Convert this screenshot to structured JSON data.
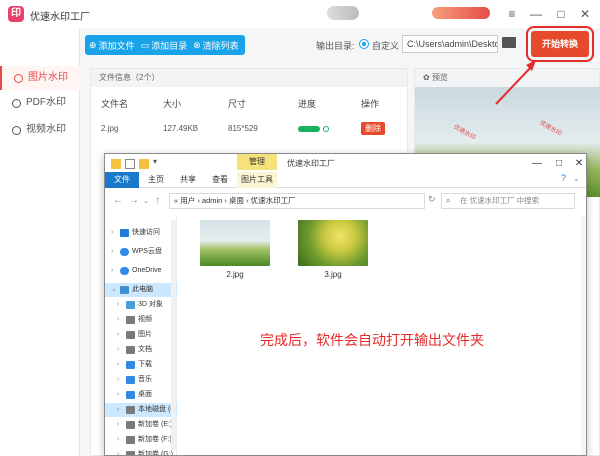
{
  "app": {
    "title": "优速水印工厂",
    "window_controls": [
      "≡",
      "—",
      "□",
      "✕"
    ]
  },
  "sidebar": {
    "items": [
      {
        "label": "图片水印",
        "active": true
      },
      {
        "label": "PDF水印",
        "active": false
      },
      {
        "label": "视频水印",
        "active": false
      }
    ]
  },
  "toolbar": {
    "add_file": "添加文件",
    "add_dir": "添加目录",
    "clear_list": "清除列表",
    "output_label": "输出目录:",
    "radio_custom": "自定义",
    "output_path": "C:\\Users\\admin\\Deskto",
    "start_button": "开始转换"
  },
  "file_panel": {
    "header": "文件信息（2个）",
    "columns": [
      "文件名",
      "大小",
      "尺寸",
      "进度",
      "操作"
    ],
    "rows": [
      {
        "name": "2.jpg",
        "size": "127.49KB",
        "dims": "815*529",
        "progress": 1.0,
        "action": "删除"
      }
    ]
  },
  "preview_panel": {
    "header": "预览",
    "watermark_text": "优速水印"
  },
  "explorer": {
    "title": "优速水印工厂",
    "manage_tab": "管理",
    "ribbon_tabs": [
      "文件",
      "主页",
      "共享",
      "查看",
      "图片工具"
    ],
    "address": "«  用户  ›  admin  ›  桌面  ›  优速水印工厂",
    "search_placeholder": "在 优速水印工厂 中搜索",
    "nav_items": [
      {
        "label": "快速访问",
        "color": "#1e7dd6"
      },
      {
        "label": "WPS云盘",
        "color": "#2f8ae6"
      },
      {
        "label": "OneDrive",
        "color": "#2f8ae6"
      },
      {
        "label": "此电脑",
        "color": "#3e8ed0"
      },
      {
        "label": "3D 对象",
        "color": "#4aa0d8"
      },
      {
        "label": "视频",
        "color": "#7a7a7a"
      },
      {
        "label": "图片",
        "color": "#7a7a7a"
      },
      {
        "label": "文档",
        "color": "#7a7a7a"
      },
      {
        "label": "下载",
        "color": "#2f8ae6"
      },
      {
        "label": "音乐",
        "color": "#2f8ae6"
      },
      {
        "label": "桌面",
        "color": "#2f8ae6"
      },
      {
        "label": "本地磁盘 (C",
        "color": "#7a7a7a"
      },
      {
        "label": "新加卷 (E:)",
        "color": "#7a7a7a"
      },
      {
        "label": "新加卷 (F:)",
        "color": "#7a7a7a"
      },
      {
        "label": "新加卷 (G:)",
        "color": "#7a7a7a"
      }
    ],
    "files": [
      {
        "name": "2.jpg"
      },
      {
        "name": "3.jpg"
      }
    ],
    "message": "完成后，软件会自动打开输出文件夹"
  },
  "colors": {
    "accent_red": "#e64a49",
    "accent_blue": "#1aa3e8",
    "progress_green": "#18b15c"
  }
}
